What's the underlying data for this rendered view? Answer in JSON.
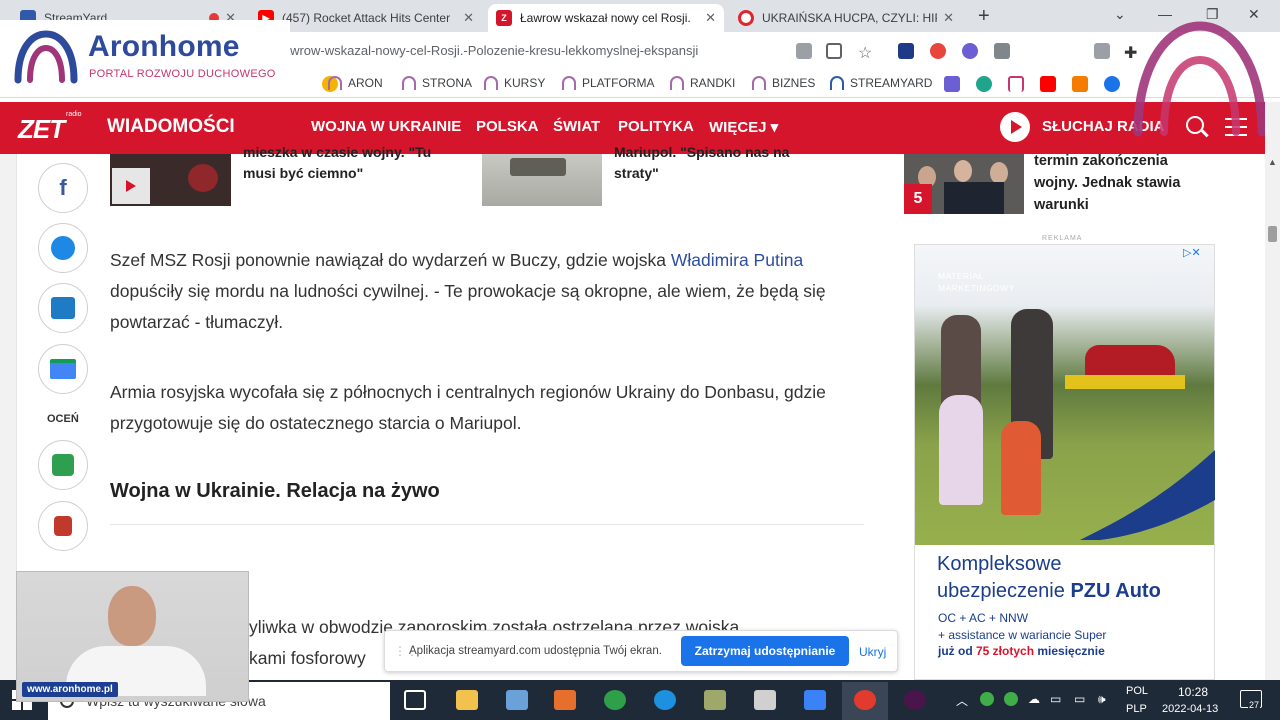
{
  "browser": {
    "tabs": [
      {
        "title": "StreamYard",
        "favicon_color": "#2f5aa8"
      },
      {
        "title": "(457) Rocket Attack Hits Center",
        "favicon_color": "#ff0000"
      },
      {
        "title": "Ławrow wskazał nowy cel Rosji.",
        "favicon_color": "#d5152b"
      },
      {
        "title": "UKRAIŃSKA HUCPA, CZYLI: HIPO",
        "favicon_color": "#e0262c"
      }
    ],
    "new_tab": "+",
    "url": "/Lawrow-wskazal-nowy-cel-Rosji.-Polozenie-kresu-lekkomyslnej-ekspansji",
    "bookmarks": [
      "ARON",
      "STRONA",
      "KURSY",
      "PLATFORMA",
      "RANDKI",
      "BIZNES",
      "STREAMYARD"
    ]
  },
  "overlay": {
    "brand": "Aronhome",
    "tagline": "PORTAL ROZWOJU DUCHOWEGO",
    "brand_color": "#2d4a9c",
    "tagline_color": "#c6366f"
  },
  "site": {
    "logo": "ZET",
    "logo_radio": "radio",
    "section": "WIADOMOŚCI",
    "nav": [
      "WOJNA W UKRAINIE",
      "POLSKA",
      "ŚWIAT",
      "POLITYKA",
      "WIĘCEJ ▾"
    ],
    "listen": "SŁUCHAJ RADIA",
    "accent": "#d5152b"
  },
  "social": {
    "rate_label": "OCEŃ"
  },
  "related": {
    "left_title_line1": "mieszka w czasie wojny. \"Tu",
    "left_title_line2": "musi być ciemno\"",
    "right_title_line1": "Mariupol. \"Spisano nas na",
    "right_title_line2": "straty\""
  },
  "article": {
    "p1_before": "Szef MSZ Rosji ponownie nawiązał do wydarzeń w Buczy, gdzie wojska ",
    "p1_link": "Władimira Putina",
    "p1_line2": "dopuściły się mordu na ludności cywilnej. - Te prowokacje są okropne, ale wiem, że będą się",
    "p1_line3": "powtarzać - tłumaczył.",
    "p2_line1": "Armia rosyjska wycofała się z północnych i centralnych regionów Ukrainy do Donbasu, gdzie",
    "p2_line2": "przygotowuje się do ostatecznego starcia o Mariupol.",
    "heading": "Wojna w Ukrainie. Relacja na żywo",
    "p3_line1": "yliwka w obwodzie zaporoskim została ostrzelana przez wojska",
    "p3_line2": "kami fosforowy"
  },
  "sidebar": {
    "rank": "5",
    "line1": "termin zakończenia",
    "line2": "wojny. Jednak stawia",
    "line3": "warunki",
    "ad_label": "REKLAMA"
  },
  "ad": {
    "tag_line1": "MATERIAŁ",
    "tag_line2": "MARKETINGOWY",
    "title_line1": "Kompleksowe",
    "title_line2_pre": "ubezpieczenie ",
    "title_line2_brand": "PZU Auto",
    "line1": "OC + AC + NNW",
    "line2": "+ assistance w wariancie Super",
    "line3_pre": "już od ",
    "line3_price": "75 złotych",
    "line3_post": " miesięcznie",
    "brand_color": "#1b3d8c"
  },
  "webcam": {
    "watermark": "www.aronhome.pl"
  },
  "sharing": {
    "message": "Aplikacja streamyard.com udostępnia Twój ekran.",
    "stop_label": "Zatrzymaj udostępnianie",
    "hide_label": "Ukryj"
  },
  "taskbar": {
    "search_placeholder": "Wpisz tu wyszukiwane słowa",
    "lang1": "POL",
    "lang2": "PLP",
    "time": "10:28",
    "date": "2022-04-13",
    "notifications": "27"
  }
}
